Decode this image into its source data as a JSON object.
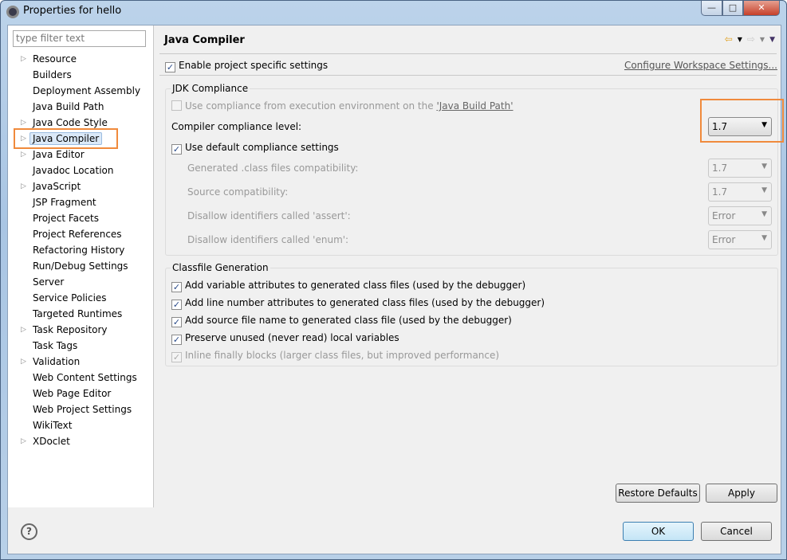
{
  "window": {
    "title": "Properties for hello",
    "controls": {
      "minimize": "—",
      "maximize": "□",
      "close": "✕"
    }
  },
  "filter": {
    "placeholder": "type filter text"
  },
  "tree": [
    {
      "label": "Resource",
      "expandable": true
    },
    {
      "label": "Builders",
      "expandable": false
    },
    {
      "label": "Deployment Assembly",
      "expandable": false
    },
    {
      "label": "Java Build Path",
      "expandable": false
    },
    {
      "label": "Java Code Style",
      "expandable": true
    },
    {
      "label": "Java Compiler",
      "expandable": true,
      "selected": true
    },
    {
      "label": "Java Editor",
      "expandable": true
    },
    {
      "label": "Javadoc Location",
      "expandable": false
    },
    {
      "label": "JavaScript",
      "expandable": true
    },
    {
      "label": "JSP Fragment",
      "expandable": false
    },
    {
      "label": "Project Facets",
      "expandable": false
    },
    {
      "label": "Project References",
      "expandable": false
    },
    {
      "label": "Refactoring History",
      "expandable": false
    },
    {
      "label": "Run/Debug Settings",
      "expandable": false
    },
    {
      "label": "Server",
      "expandable": false
    },
    {
      "label": "Service Policies",
      "expandable": false
    },
    {
      "label": "Targeted Runtimes",
      "expandable": false
    },
    {
      "label": "Task Repository",
      "expandable": true
    },
    {
      "label": "Task Tags",
      "expandable": false
    },
    {
      "label": "Validation",
      "expandable": true
    },
    {
      "label": "Web Content Settings",
      "expandable": false
    },
    {
      "label": "Web Page Editor",
      "expandable": false
    },
    {
      "label": "Web Project Settings",
      "expandable": false
    },
    {
      "label": "WikiText",
      "expandable": false
    },
    {
      "label": "XDoclet",
      "expandable": true
    }
  ],
  "page": {
    "title": "Java Compiler",
    "enable_specific": {
      "label": "Enable project specific settings",
      "checked": true
    },
    "configure_link": "Configure Workspace Settings...",
    "jdk": {
      "label": "JDK Compliance",
      "use_env": {
        "label": "Use compliance from execution environment on the ",
        "link": "'Java Build Path'",
        "checked": false,
        "enabled": false
      },
      "level_label": "Compiler compliance level:",
      "level_value": "1.7",
      "use_default": {
        "label": "Use default compliance settings",
        "checked": true
      },
      "settings": [
        {
          "label": "Generated .class files compatibility:",
          "value": "1.7"
        },
        {
          "label": "Source compatibility:",
          "value": "1.7"
        },
        {
          "label": "Disallow identifiers called 'assert':",
          "value": "Error"
        },
        {
          "label": "Disallow identifiers called 'enum':",
          "value": "Error"
        }
      ]
    },
    "classfile": {
      "label": "Classfile Generation",
      "options": [
        {
          "label": "Add variable attributes to generated class files (used by the debugger)",
          "checked": true,
          "enabled": true
        },
        {
          "label": "Add line number attributes to generated class files (used by the debugger)",
          "checked": true,
          "enabled": true
        },
        {
          "label": "Add source file name to generated class file (used by the debugger)",
          "checked": true,
          "enabled": true
        },
        {
          "label": "Preserve unused (never read) local variables",
          "checked": true,
          "enabled": true
        },
        {
          "label": "Inline finally blocks (larger class files, but improved performance)",
          "checked": true,
          "enabled": false
        }
      ]
    },
    "restore_defaults": "Restore Defaults",
    "apply": "Apply"
  },
  "footer": {
    "help": "?",
    "ok": "OK",
    "cancel": "Cancel"
  },
  "colors": {
    "highlight": "#f08a3c"
  }
}
